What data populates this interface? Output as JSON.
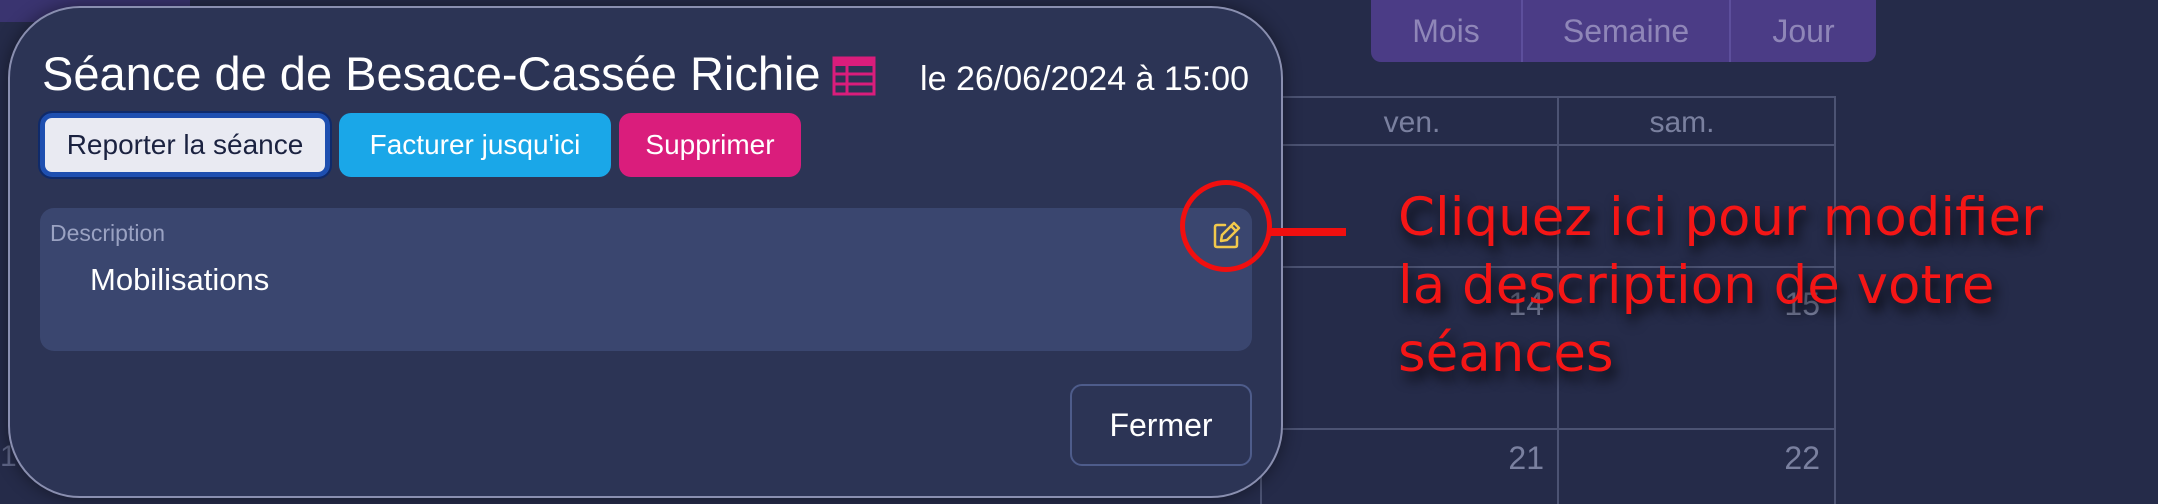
{
  "calendar": {
    "view_buttons": [
      "Mois",
      "Semaine",
      "Jour"
    ],
    "day_headers": [
      "ven.",
      "sam."
    ],
    "day_numbers": [
      "14",
      "15",
      "21",
      "22"
    ],
    "left_partial_number": "1"
  },
  "modal": {
    "title": "Séance de de Besace-Cassée Richie",
    "date": "le 26/06/2024 à 15:00",
    "buttons": {
      "report": "Reporter la séance",
      "bill": "Facturer jusqu'ici",
      "delete": "Supprimer",
      "close": "Fermer"
    },
    "description": {
      "label": "Description",
      "value": "Mobilisations"
    }
  },
  "annotation": {
    "lines": [
      "Cliquez ici pour modifier",
      "la description de votre",
      "séances"
    ]
  },
  "colors": {
    "accent_blue": "#1aa7e8",
    "accent_pink": "#da1d7c",
    "annotation_red": "#f10f0f",
    "edit_icon_yellow": "#f2c94c"
  },
  "icons": {
    "table": "table-icon",
    "edit": "edit-icon"
  }
}
